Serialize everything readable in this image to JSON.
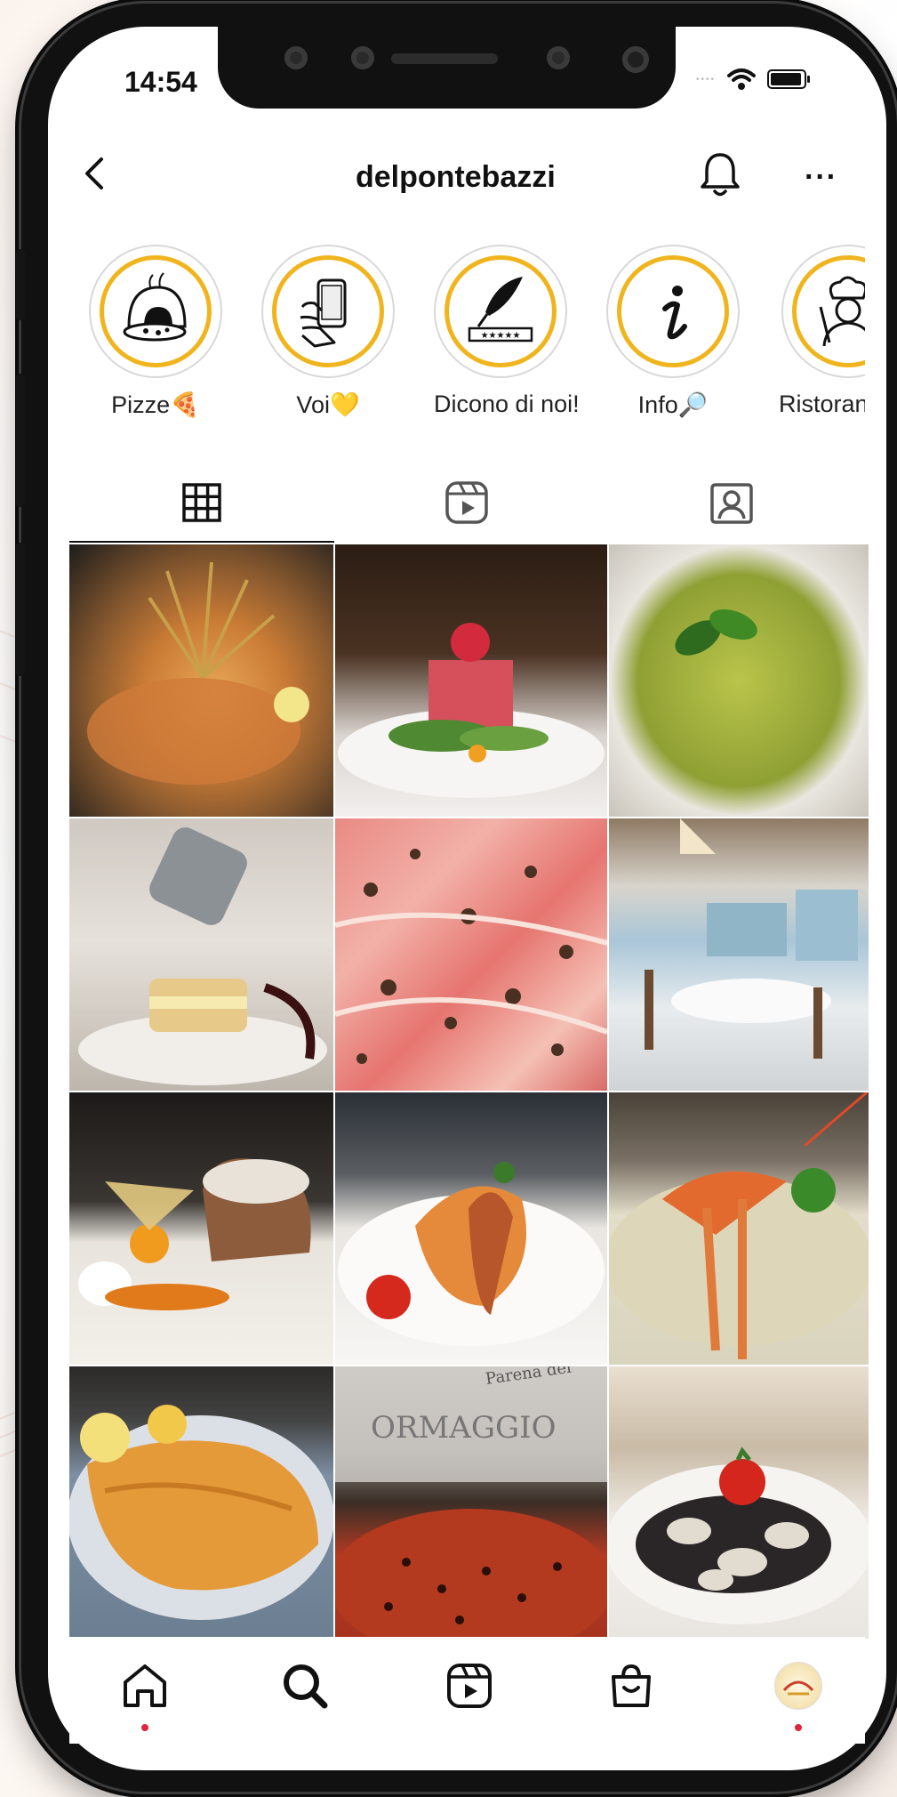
{
  "status": {
    "time": "14:54"
  },
  "header": {
    "username": "delpontebazzi"
  },
  "highlights": [
    {
      "label": "Pizze🍕",
      "icon": "pizza-oven-icon"
    },
    {
      "label": "Voi💛",
      "icon": "phone-in-hand-icon"
    },
    {
      "label": "Dicono di noi!",
      "icon": "quill-stars-icon"
    },
    {
      "label": "Info🔎",
      "icon": "info-icon"
    },
    {
      "label": "Ristoran",
      "icon": "chef-icon"
    }
  ],
  "tabs": [
    {
      "name": "posts-grid",
      "icon": "grid-icon"
    },
    {
      "name": "reels",
      "icon": "reels-icon"
    },
    {
      "name": "tagged",
      "icon": "tagged-person-icon"
    }
  ],
  "grid_posts": [
    {
      "subject": "fritto misto di mare"
    },
    {
      "subject": "tartare di tonno"
    },
    {
      "subject": "trofie al pesto"
    },
    {
      "subject": "millefoglie con zucchero a velo"
    },
    {
      "subject": "prosciutto crudo"
    },
    {
      "subject": "sala del ristorante"
    },
    {
      "subject": "tortino con physalis"
    },
    {
      "subject": "polpo e risotto"
    },
    {
      "subject": "risotto con scampi"
    },
    {
      "subject": "cotoletta"
    },
    {
      "subject": "pizza al forno"
    },
    {
      "subject": "spaghetti alle vongole"
    }
  ],
  "bottom_nav": [
    "home-icon",
    "search-icon",
    "reels-icon",
    "shop-icon",
    "profile-avatar"
  ]
}
